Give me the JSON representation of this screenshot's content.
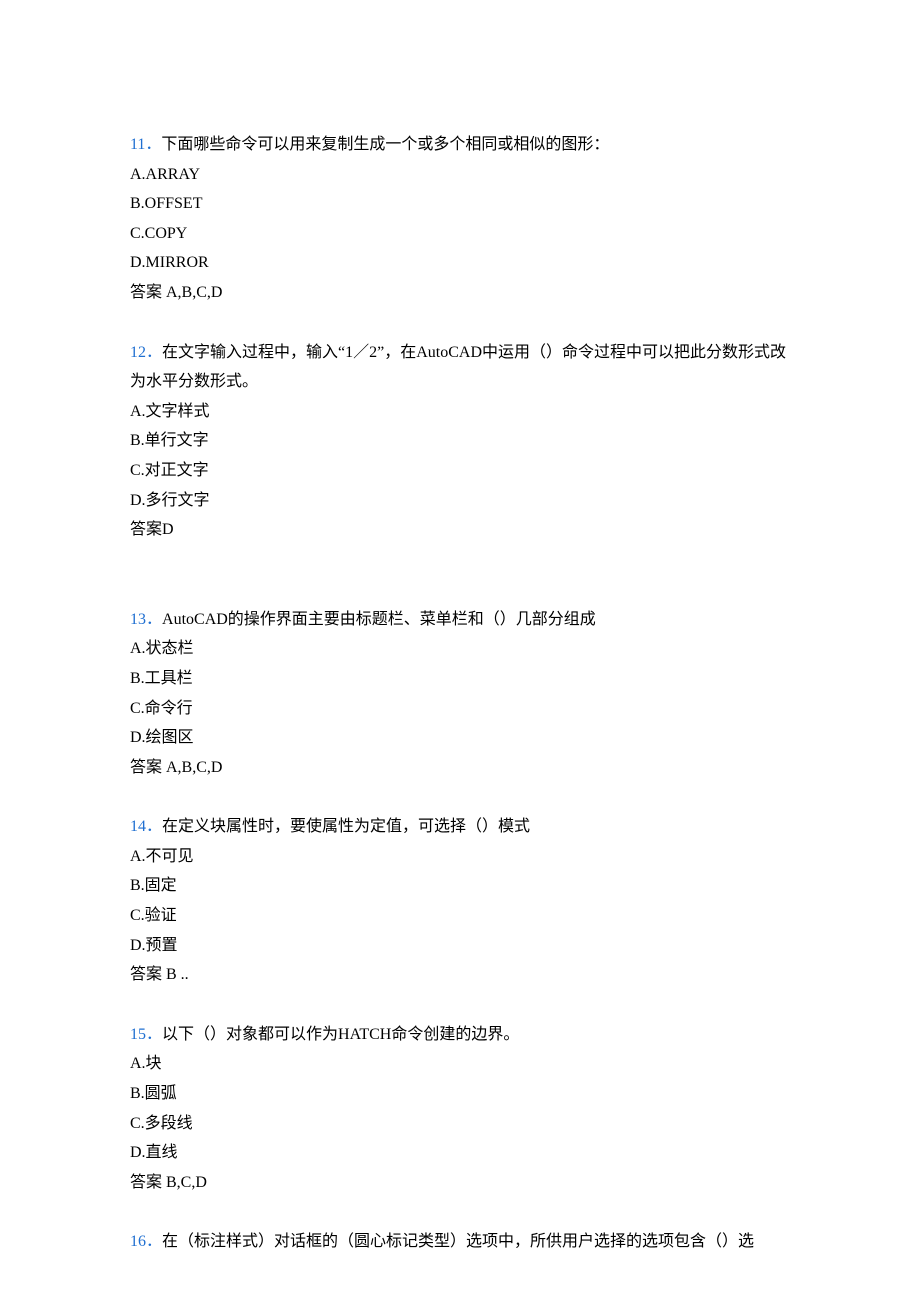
{
  "questions": [
    {
      "number": "11．",
      "text": "下面哪些命令可以用来复制生成一个或多个相同或相似的图形：",
      "options": [
        "A.ARRAY",
        "B.OFFSET",
        "C.COPY",
        "D.MIRROR"
      ],
      "answer": "答案 A,B,C,D"
    },
    {
      "number": "12．",
      "text": "在文字输入过程中，输入“1／2”，在AutoCAD中运用（）命令过程中可以把此分数形式改为水平分数形式。",
      "options": [
        "A.文字样式",
        "B.单行文字",
        "C.对正文字",
        "D.多行文字"
      ],
      "answer": "答案D"
    },
    {
      "number": "13．",
      "text": "AutoCAD的操作界面主要由标题栏、菜单栏和（）几部分组成",
      "options": [
        "A.状态栏",
        "B.工具栏",
        "C.命令行",
        "D.绘图区"
      ],
      "answer": "答案 A,B,C,D"
    },
    {
      "number": "14．",
      "text": "在定义块属性时，要使属性为定值，可选择（）模式",
      "options": [
        "A.不可见",
        "B.固定",
        "C.验证",
        "D.预置"
      ],
      "answer": "答案 B .."
    },
    {
      "number": "15．",
      "text": "以下（）对象都可以作为HATCH命令创建的边界。",
      "options": [
        "A.块",
        "B.圆弧",
        "C.多段线",
        "D.直线"
      ],
      "answer": "答案 B,C,D"
    },
    {
      "number": "16．",
      "text": "在（标注样式）对话框的（圆心标记类型）选项中，所供用户选择的选项包含（）选",
      "options": [],
      "answer": ""
    }
  ]
}
